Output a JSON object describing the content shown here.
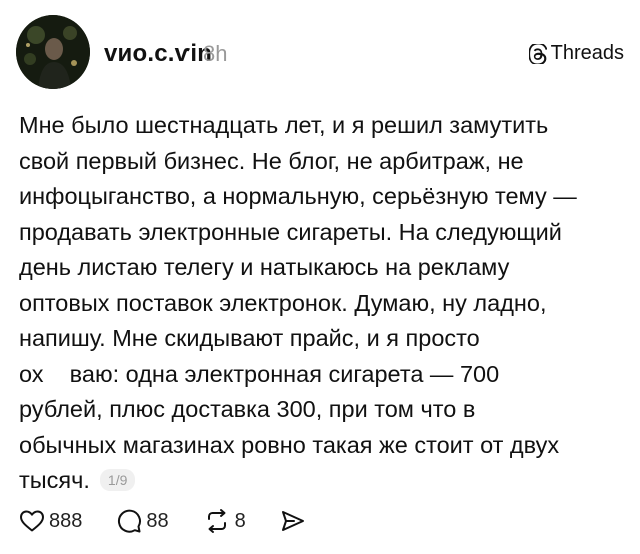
{
  "post": {
    "username": "vиo.c.ѵin",
    "time": "8h",
    "platform_label": "Threads",
    "body_lines": [
      "Мне было шестнадцать лет, и я решил замутить",
      "свой первый бизнес. Не блог, не арбитраж, не",
      "инфоцыганство, а нормальную, серьёзную тему —",
      "продавать электронные сигареты. На следующий",
      "день листаю телегу и натыкаюсь на рекламу",
      "оптовых поставок электронок. Думаю, ну ладно,",
      "напишу. Мне скидывают прайс, и я просто",
      "ох    ваю: одна электронная сигарета — 700",
      "рублей, плюс доставка 300, при том что в",
      "обычных магазинах ровно такая же стоит от двух",
      "тысяч."
    ],
    "page_indicator": "1/9"
  },
  "actions": {
    "likes": "888",
    "comments": "88",
    "reposts": "8"
  },
  "icons": {
    "avatar": "user-avatar-photo",
    "threads": "threads-logo-icon",
    "like": "heart-icon",
    "comment": "comment-bubble-icon",
    "repost": "repost-icon",
    "share": "share-send-icon"
  }
}
